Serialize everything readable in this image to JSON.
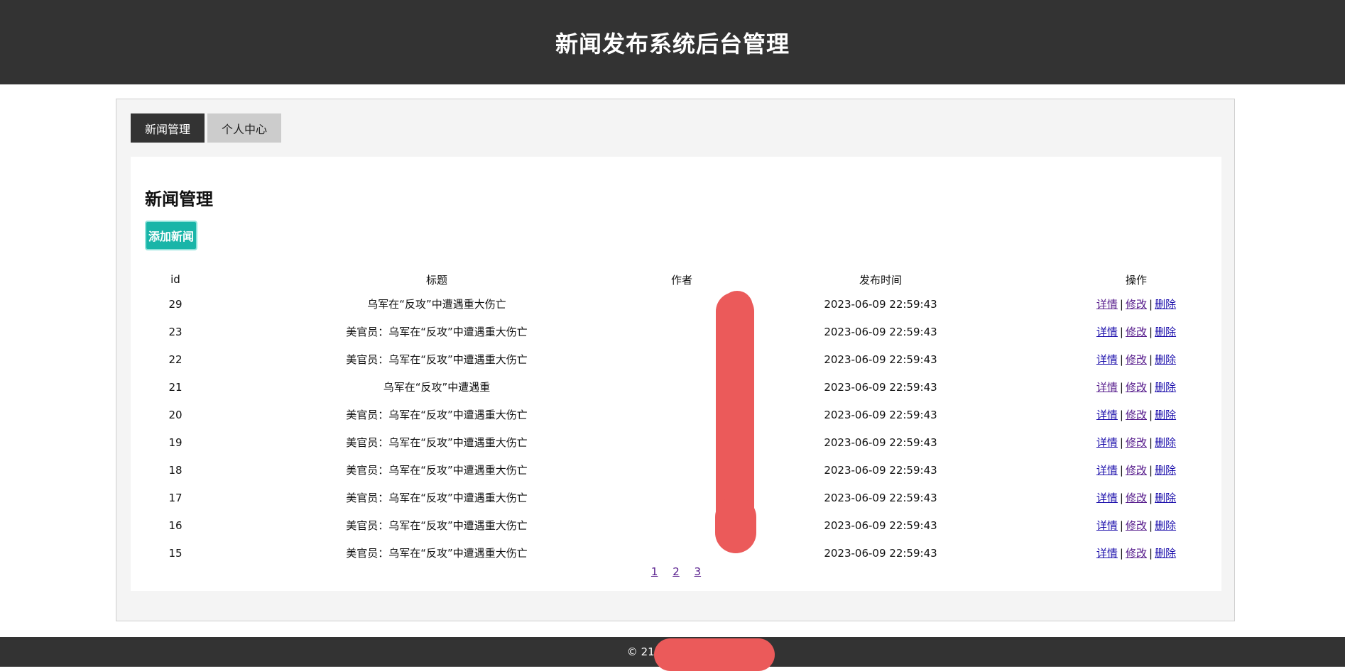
{
  "header": {
    "title": "新闻发布系统后台管理"
  },
  "tabs": [
    {
      "label": "新闻管理",
      "active": true
    },
    {
      "label": "个人中心",
      "active": false
    }
  ],
  "panel": {
    "title": "新闻管理",
    "add_button": "添加新闻"
  },
  "table": {
    "headers": {
      "id": "id",
      "title": "标题",
      "author": "作者",
      "time": "发布时间",
      "ops": "操作"
    },
    "ops_labels": {
      "detail": "详情",
      "edit": "修改",
      "delete": "删除",
      "sep": "|"
    },
    "rows": [
      {
        "id": "29",
        "title": "乌军在“反攻”中遭遇重大伤亡",
        "author": "",
        "time": "2023-06-09 22:59:43"
      },
      {
        "id": "23",
        "title": "美官员：乌军在“反攻”中遭遇重大伤亡",
        "author": "",
        "time": "2023-06-09 22:59:43"
      },
      {
        "id": "22",
        "title": "美官员：乌军在“反攻”中遭遇重大伤亡",
        "author": "",
        "time": "2023-06-09 22:59:43"
      },
      {
        "id": "21",
        "title": "乌军在“反攻”中遭遇重",
        "author": "",
        "time": "2023-06-09 22:59:43"
      },
      {
        "id": "20",
        "title": "美官员：乌军在“反攻”中遭遇重大伤亡",
        "author": "",
        "time": "2023-06-09 22:59:43"
      },
      {
        "id": "19",
        "title": "美官员：乌军在“反攻”中遭遇重大伤亡",
        "author": "",
        "time": "2023-06-09 22:59:43"
      },
      {
        "id": "18",
        "title": "美官员：乌军在“反攻”中遭遇重大伤亡",
        "author": "",
        "time": "2023-06-09 22:59:43"
      },
      {
        "id": "17",
        "title": "美官员：乌军在“反攻”中遭遇重大伤亡",
        "author": "",
        "time": "2023-06-09 22:59:43"
      },
      {
        "id": "16",
        "title": "美官员：乌军在“反攻”中遭遇重大伤亡",
        "author": "",
        "time": "2023-06-09 22:59:43"
      },
      {
        "id": "15",
        "title": "美官员：乌军在“反攻”中遭遇重大伤亡",
        "author": "",
        "time": "2023-06-09 22:59:43"
      }
    ]
  },
  "pagination": {
    "pages": [
      "1",
      "2",
      "3"
    ]
  },
  "footer": {
    "text": "© 215"
  },
  "colors": {
    "header_bg": "#333333",
    "accent": "#19b5a8",
    "redaction": "#eb5a5a"
  }
}
